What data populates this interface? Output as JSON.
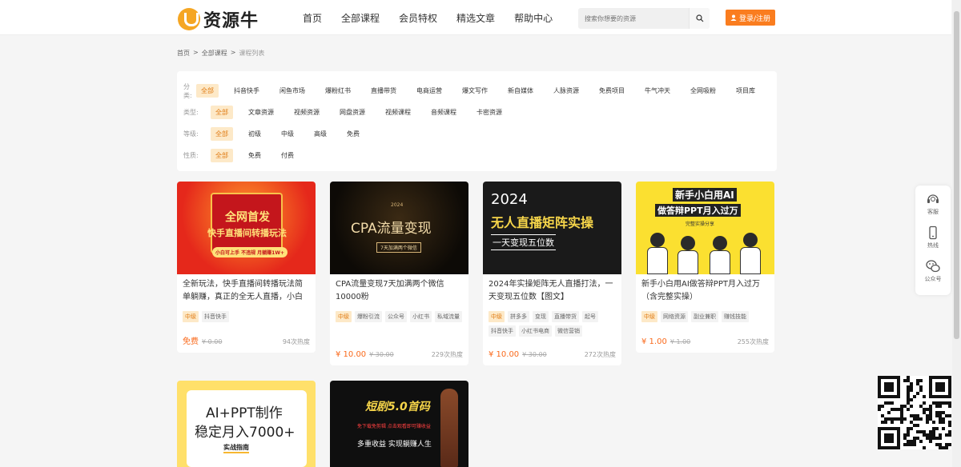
{
  "header": {
    "logo_text": "资源牛",
    "nav": [
      "首页",
      "全部课程",
      "会员特权",
      "精选文章",
      "帮助中心"
    ],
    "search_placeholder": "搜索你想要的资源",
    "login_label": "登录/注册"
  },
  "breadcrumb": [
    "首页",
    ">",
    "全部课程",
    ">",
    "课程列表"
  ],
  "filters": [
    {
      "label": "分类:",
      "options": [
        "全部",
        "抖音快手",
        "闲鱼市场",
        "爆粉红书",
        "直播带货",
        "电商运营",
        "爆文写作",
        "新自媒体",
        "人脉资源",
        "免费项目",
        "牛气冲天",
        "全网吸粉",
        "项目库"
      ]
    },
    {
      "label": "类型:",
      "options": [
        "全部",
        "文章资源",
        "视频资源",
        "网盘资源",
        "视频课程",
        "音频课程",
        "卡密资源"
      ]
    },
    {
      "label": "等级:",
      "options": [
        "全部",
        "初级",
        "中级",
        "高级",
        "免费"
      ]
    },
    {
      "label": "性质:",
      "options": [
        "全部",
        "免费",
        "付费"
      ]
    }
  ],
  "cards": [
    {
      "title": "全新玩法，快手直播间转播玩法简单躺赚，真正的全无人直播，小白",
      "tags": [
        "中级",
        "抖音快手"
      ],
      "price": "免费",
      "original_price": "¥ 0.00",
      "heat": "94次热度",
      "thumb": {
        "line1": "全网首发",
        "line2": "快手直播间转播玩法",
        "line3": "小白可上手 不违规 月躺赚1W+"
      }
    },
    {
      "title": "CPA流量变现7天加满两个微信10000粉",
      "tags": [
        "中级",
        "爆粉引流",
        "公众号",
        "小红书",
        "私域流量"
      ],
      "price": "¥ 10.00",
      "original_price": "¥ 30.00",
      "heat": "229次热度",
      "thumb": {
        "line1": "2024",
        "line2": "CPA流量变现",
        "line3": "7天加满两个微信"
      }
    },
    {
      "title": "2024年实操矩阵无人直播打法，一天变现五位数【图文】",
      "tags": [
        "中级",
        "拼多多",
        "变现",
        "直播带货",
        "起号",
        "抖音快手",
        "小红书电商",
        "微信营销"
      ],
      "price": "¥ 10.00",
      "original_price": "¥ 30.00",
      "heat": "272次热度",
      "thumb": {
        "line1": "2024",
        "line2": "无人直播矩阵实操",
        "line3": "一天变现五位数"
      }
    },
    {
      "title": "新手小白用AI做答辩PPT月入过万（含完整实操）",
      "tags": [
        "中级",
        "网络资源",
        "副业兼职",
        "赚钱技能"
      ],
      "price": "¥ 1.00",
      "original_price": "¥ 1.00",
      "heat": "255次热度",
      "thumb": {
        "line1": "新手小白用AI",
        "line2": "做答辩PPT月入过万",
        "line3": "完整实操分享"
      }
    },
    {
      "title": "",
      "tags": [],
      "price": "",
      "original_price": "",
      "heat": "",
      "thumb": {
        "line1": "AI+PPT制作",
        "line2": "稳定月入7000+",
        "line3": "实战指南"
      }
    },
    {
      "title": "",
      "tags": [],
      "price": "",
      "original_price": "",
      "heat": "",
      "thumb": {
        "line1": "短剧5.0首码",
        "line2": "免下载免剪辑 点击观看即可赚收益",
        "line3": "多重收益  实现躺赚人生"
      }
    }
  ],
  "float_bar": [
    {
      "label": "客服",
      "icon": "headset-icon"
    },
    {
      "label": "热线",
      "icon": "phone-icon"
    },
    {
      "label": "公众号",
      "icon": "wechat-icon"
    }
  ],
  "colors": {
    "accent": "#fa7d1f",
    "tag_active_bg": "#fde9c8",
    "price": "#fa6a1c"
  }
}
